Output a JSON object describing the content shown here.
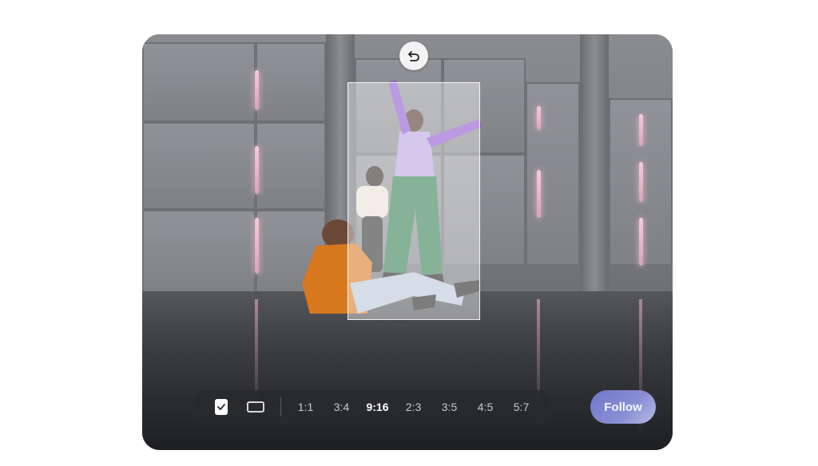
{
  "toolbar": {
    "icons": [
      "crop-portrait-icon",
      "crop-landscape-icon"
    ],
    "ratios": [
      {
        "label": "1:1",
        "active": false
      },
      {
        "label": "3:4",
        "active": false
      },
      {
        "label": "9:16",
        "active": true
      },
      {
        "label": "2:3",
        "active": false
      },
      {
        "label": "3:5",
        "active": false
      },
      {
        "label": "4:5",
        "active": false
      },
      {
        "label": "5:7",
        "active": false
      }
    ]
  },
  "follow_button": {
    "label": "Follow"
  },
  "colors": {
    "accent": "#7f86cf",
    "toolbar_bg": "#2b2d31",
    "crop_overlay": "#ffffff"
  }
}
